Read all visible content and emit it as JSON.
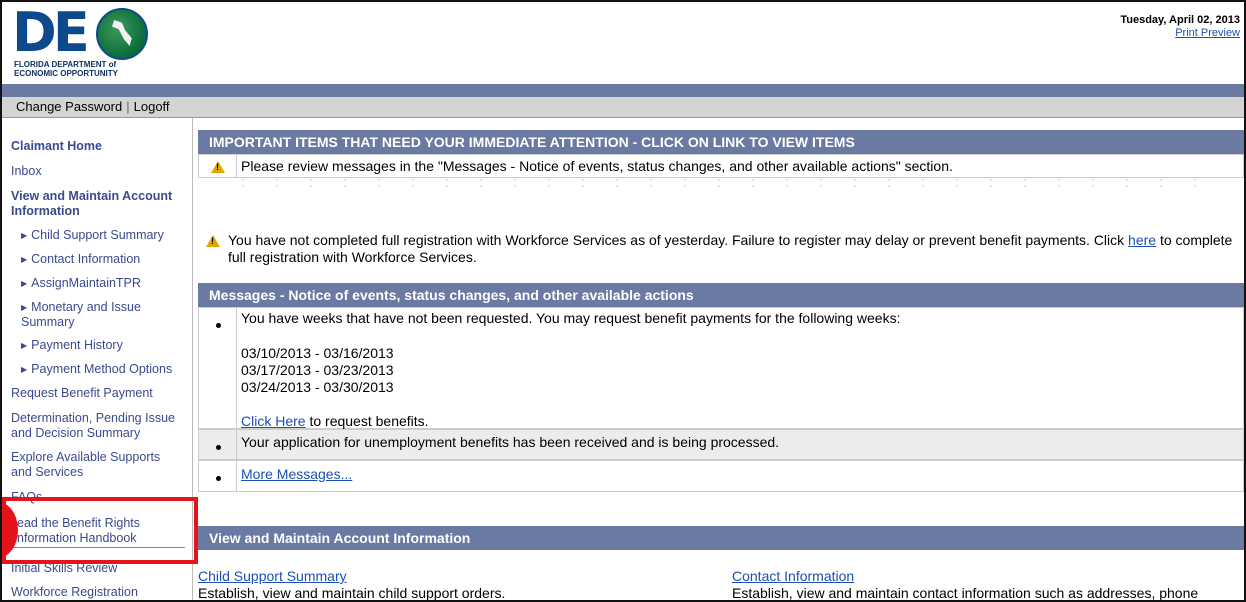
{
  "header": {
    "logo_letters": "DE",
    "logo_text_line1": "FLORIDA DEPARTMENT of",
    "logo_text_line2": "ECONOMIC OPPORTUNITY",
    "date": "Tuesday, April 02, 2013",
    "print_preview": "Print Preview"
  },
  "toolbar": {
    "change_password": "Change Password",
    "separator": "|",
    "logoff": "Logoff"
  },
  "sidebar": {
    "claimant_home": "Claimant Home",
    "inbox": "Inbox",
    "view_maintain": "View and Maintain Account Information",
    "subitems": [
      "Child Support Summary",
      "Contact Information",
      "AssignMaintainTPR",
      "Monetary and Issue Summary",
      "Payment History",
      "Payment Method Options"
    ],
    "request_benefit_payment": "Request Benefit Payment",
    "determination": "Determination, Pending Issue and Decision Summary",
    "explore": "Explore Available Supports and Services",
    "faqs": "FAQs",
    "read_handbook": "ead the Benefit Rights nformation Handbook",
    "initial_skills": "Initial Skills Review",
    "workforce_registration": "Workforce Registration"
  },
  "important": {
    "title": "IMPORTANT ITEMS THAT NEED YOUR IMMEDIATE ATTENTION - CLICK ON LINK TO VIEW ITEMS",
    "message": "Please review messages in the \"Messages - Notice of events, status changes, and other available actions\" section."
  },
  "registration_warning": {
    "text_before": "You have not completed full registration with Workforce Services as of yesterday. Failure to register may delay or prevent benefit payments. Click ",
    "link": "here",
    "text_after": " to complete full registration with Workforce Services."
  },
  "messages": {
    "title": "Messages - Notice of events, status changes, and other available actions",
    "weeks_intro": "You have weeks that have not been requested. You may request benefit payments for the following weeks:",
    "weeks": [
      "03/10/2013 - 03/16/2013",
      "03/17/2013 - 03/23/2013",
      "03/24/2013 - 03/30/2013"
    ],
    "click_here": "Click Here",
    "click_here_suffix": " to request benefits.",
    "application_received": "Your application for unemployment benefits has been received and is being processed.",
    "more_messages": "More Messages..."
  },
  "account_section": {
    "title": "View and Maintain Account Information",
    "child_support_link": "Child Support Summary",
    "child_support_desc": "Establish, view and maintain child support orders.",
    "contact_link": "Contact Information",
    "contact_desc": "Establish, view and maintain contact information such as addresses, phone"
  },
  "colors": {
    "section_bar": "#6b7aa3",
    "sidebar_link": "#3a4a8e",
    "link": "#1a4fb5",
    "highlight": "#e6131a"
  }
}
